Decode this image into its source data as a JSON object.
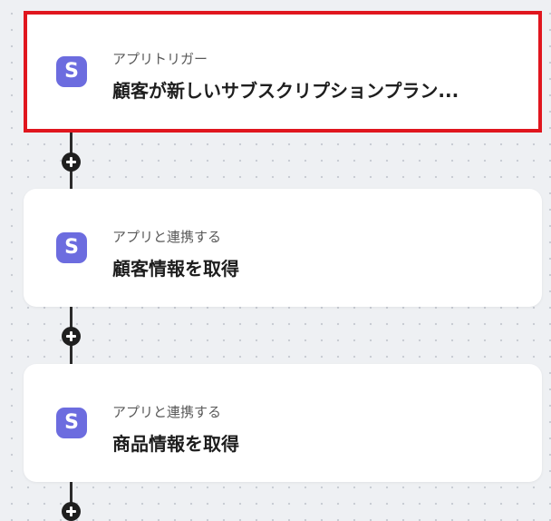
{
  "colors": {
    "canvas_background": "#eef0f3",
    "card_background": "#ffffff",
    "selected_outline": "#e0161e",
    "app_icon": "#6c6cdf",
    "connector": "#2b2b2b"
  },
  "steps": [
    {
      "label": "アプリトリガー",
      "title": "顧客が新しいサブスクリプションプラン...",
      "icon_letter": "S",
      "icon_name": "stripe-app-icon",
      "selected": true
    },
    {
      "label": "アプリと連携する",
      "title": "顧客情報を取得",
      "icon_letter": "S",
      "icon_name": "stripe-app-icon",
      "selected": false
    },
    {
      "label": "アプリと連携する",
      "title": "商品情報を取得",
      "icon_letter": "S",
      "icon_name": "stripe-app-icon",
      "selected": false
    }
  ],
  "add_step_icon": "plus-icon"
}
